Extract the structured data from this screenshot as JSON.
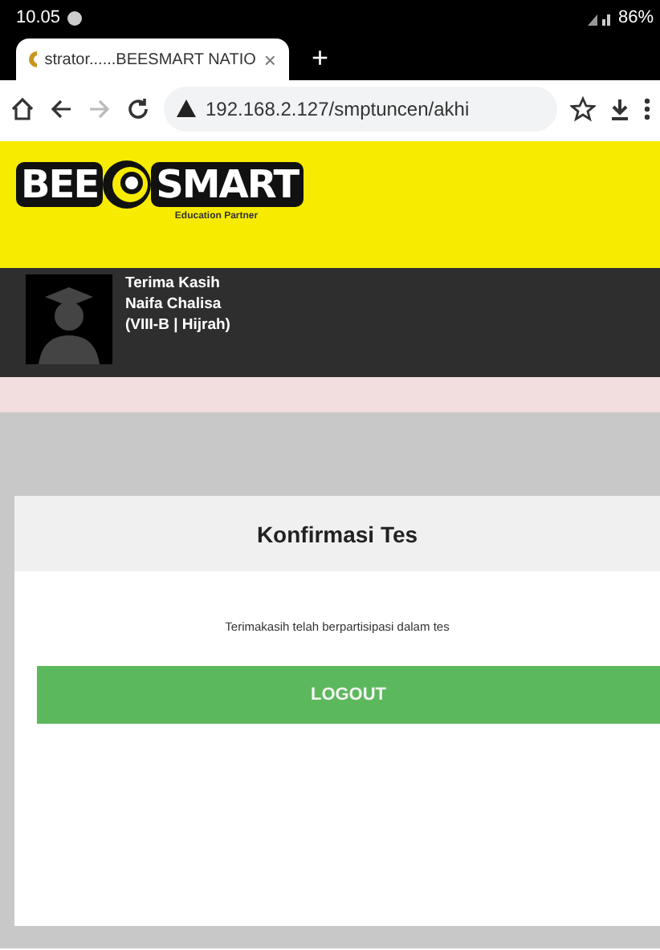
{
  "status_bar": {
    "time": "10.05",
    "battery": "86%"
  },
  "browser": {
    "tab": {
      "title": "strator......BEESMART NATIO",
      "close": "×",
      "selected": true
    },
    "new_tab": "+",
    "forward_disabled": true,
    "url": "192.168.2.127/smptuncen/akhi"
  },
  "header": {
    "logo_left": "BEE",
    "logo_right": "SMART",
    "tagline": "Education Partner"
  },
  "user": {
    "greeting": "Terima Kasih",
    "name": "Naifa Chalisa",
    "class": "(VIII-B | Hijrah)"
  },
  "card": {
    "title": "Konfirmasi Tes",
    "message": "Terimakasih telah berpartisipasi dalam tes",
    "button": "LOGOUT"
  }
}
